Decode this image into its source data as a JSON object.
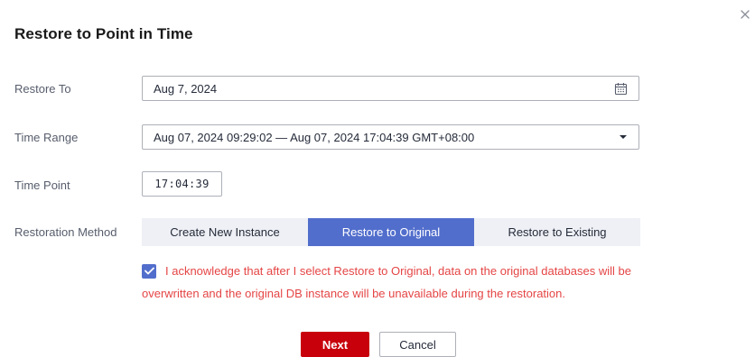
{
  "dialog": {
    "title": "Restore to Point in Time",
    "close_icon": "close-icon"
  },
  "form": {
    "restore_to": {
      "label": "Restore To",
      "value": "Aug 7, 2024",
      "icon": "calendar-icon"
    },
    "time_range": {
      "label": "Time Range",
      "value": "Aug 07, 2024 09:29:02 — Aug 07, 2024 17:04:39 GMT+08:00",
      "icon": "dropdown-caret-icon"
    },
    "time_point": {
      "label": "Time Point",
      "value": "17:04:39"
    },
    "restoration_method": {
      "label": "Restoration Method",
      "options": [
        "Create New Instance",
        "Restore to Original",
        "Restore to Existing"
      ],
      "selected": "Restore to Original"
    }
  },
  "acknowledgement": {
    "checked": true,
    "line1": "I acknowledge that after I select Restore to Original, data on the original databases will be",
    "line2": "overwritten and the original DB instance will be unavailable during the restoration."
  },
  "buttons": {
    "next": "Next",
    "cancel": "Cancel"
  },
  "colors": {
    "primary": "#c7000b",
    "accent": "#526ecc",
    "warning_text": "#e54545",
    "segment_bg": "#eef0f5"
  }
}
